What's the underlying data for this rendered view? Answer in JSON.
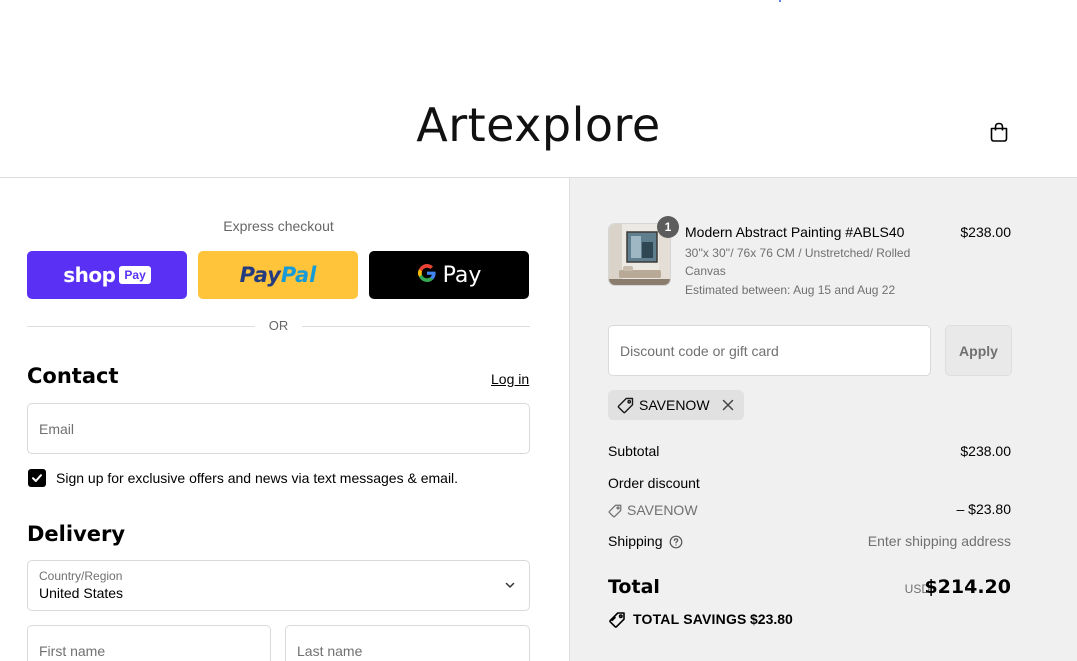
{
  "header": {
    "brand": "Artexplore",
    "cart_icon": "shopping-bag-icon"
  },
  "express": {
    "title": "Express checkout",
    "shop_pay": {
      "brand": "shop",
      "badge": "Pay"
    },
    "paypal": {
      "part1": "Pay",
      "part2": "Pal"
    },
    "gpay": {
      "label": "Pay"
    },
    "divider": "OR"
  },
  "contact": {
    "title": "Contact",
    "login_label": "Log in",
    "email_placeholder": "Email",
    "marketing_label": "Sign up for exclusive offers and news via text messages & email.",
    "marketing_checked": true
  },
  "delivery": {
    "title": "Delivery",
    "country_label": "Country/Region",
    "country_value": "United States",
    "first_name_placeholder": "First name",
    "last_name_placeholder": "Last name"
  },
  "summary": {
    "item": {
      "quantity": "1",
      "name": "Modern Abstract Painting #ABLS40",
      "variant": "30''x 30''/ 76x 76 CM / Unstretched/ Rolled Canvas",
      "estimate": "Estimated between: Aug 15 and Aug 22",
      "price": "$238.00"
    },
    "discount_placeholder": "Discount code or gift card",
    "apply_label": "Apply",
    "applied_code": "SAVENOW",
    "subtotal_label": "Subtotal",
    "subtotal_value": "$238.00",
    "order_discount_label": "Order discount",
    "discount_code": "SAVENOW",
    "discount_value": "– $23.80",
    "shipping_label": "Shipping",
    "shipping_value": "Enter shipping address",
    "total_label": "Total",
    "currency": "USD",
    "total_value": "$214.20",
    "savings_label": "TOTAL SAVINGS",
    "savings_value": "$23.80"
  },
  "colors": {
    "shop_pay": "#5a31f4",
    "paypal": "#ffc439",
    "gpay": "#000000",
    "summary_bg": "#f0f0f0"
  }
}
